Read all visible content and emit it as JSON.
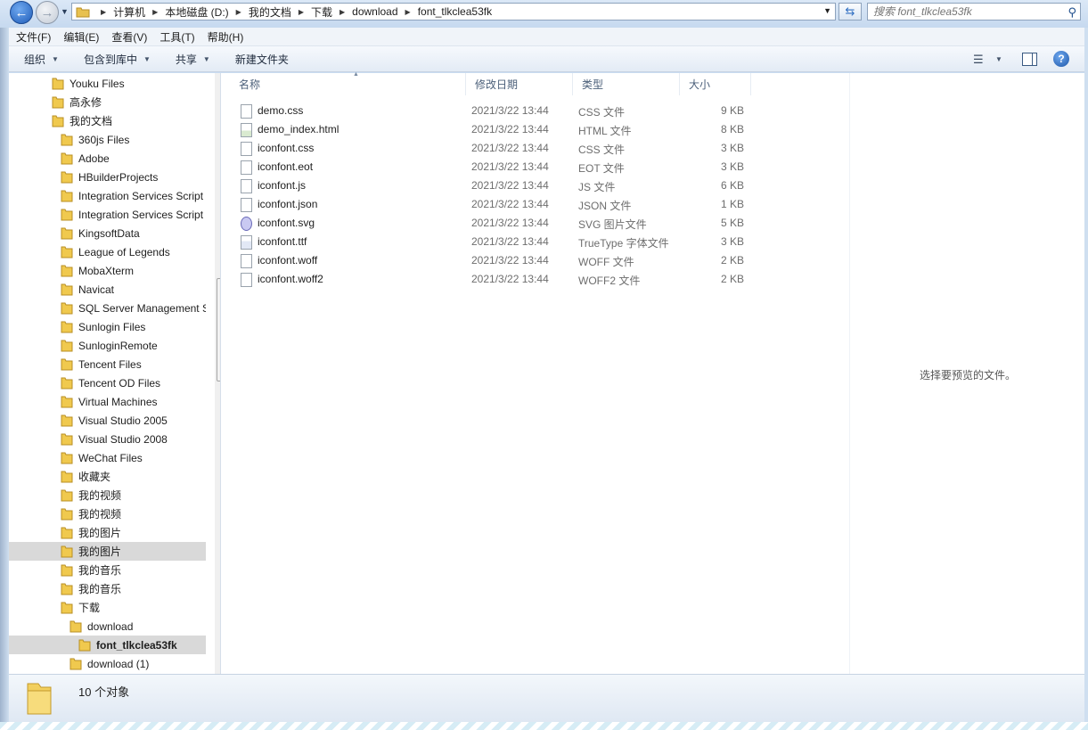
{
  "address_bar": {
    "breadcrumbs": [
      "计算机",
      "本地磁盘 (D:)",
      "我的文档",
      "下载",
      "download",
      "font_tlkclea53fk"
    ]
  },
  "search": {
    "placeholder": "搜索 font_tlkclea53fk"
  },
  "menu": [
    "文件(F)",
    "编辑(E)",
    "查看(V)",
    "工具(T)",
    "帮助(H)"
  ],
  "toolbar": {
    "organize": "组织",
    "include_in_library": "包含到库中",
    "share": "共享",
    "new_folder": "新建文件夹"
  },
  "navigation": {
    "items": [
      {
        "label": "Youku Files",
        "indent": 0
      },
      {
        "label": "高永修",
        "indent": 0
      },
      {
        "label": "我的文档",
        "indent": 0
      },
      {
        "label": "360js Files",
        "indent": 1
      },
      {
        "label": "Adobe",
        "indent": 1
      },
      {
        "label": "HBuilderProjects",
        "indent": 1
      },
      {
        "label": "Integration Services Script C",
        "indent": 1
      },
      {
        "label": "Integration Services Script T",
        "indent": 1
      },
      {
        "label": "KingsoftData",
        "indent": 1
      },
      {
        "label": "League of Legends",
        "indent": 1
      },
      {
        "label": "MobaXterm",
        "indent": 1
      },
      {
        "label": "Navicat",
        "indent": 1
      },
      {
        "label": "SQL Server Management St",
        "indent": 1
      },
      {
        "label": "Sunlogin Files",
        "indent": 1
      },
      {
        "label": "SunloginRemote",
        "indent": 1
      },
      {
        "label": "Tencent Files",
        "indent": 1
      },
      {
        "label": "Tencent OD Files",
        "indent": 1
      },
      {
        "label": "Virtual Machines",
        "indent": 1
      },
      {
        "label": "Visual Studio 2005",
        "indent": 1
      },
      {
        "label": "Visual Studio 2008",
        "indent": 1
      },
      {
        "label": "WeChat Files",
        "indent": 1
      },
      {
        "label": "收藏夹",
        "indent": 1
      },
      {
        "label": "我的视频",
        "indent": 1
      },
      {
        "label": "我的视频",
        "indent": 1
      },
      {
        "label": "我的图片",
        "indent": 1
      },
      {
        "label": "我的图片",
        "indent": 1,
        "highlighted": true
      },
      {
        "label": "我的音乐",
        "indent": 1
      },
      {
        "label": "我的音乐",
        "indent": 1
      },
      {
        "label": "下载",
        "indent": 1
      },
      {
        "label": "download",
        "indent": 2
      },
      {
        "label": "font_tlkclea53fk",
        "indent": 3,
        "selected": true
      },
      {
        "label": "download (1)",
        "indent": 2
      }
    ]
  },
  "file_list": {
    "columns": [
      "名称",
      "修改日期",
      "类型",
      "大小"
    ],
    "files": [
      {
        "name": "demo.css",
        "date": "2021/3/22 13:44",
        "type": "CSS 文件",
        "size": "9 KB",
        "icon": "css-file-icon"
      },
      {
        "name": "demo_index.html",
        "date": "2021/3/22 13:44",
        "type": "HTML 文件",
        "size": "8 KB",
        "icon": "html-file-icon"
      },
      {
        "name": "iconfont.css",
        "date": "2021/3/22 13:44",
        "type": "CSS 文件",
        "size": "3 KB",
        "icon": "css-file-icon"
      },
      {
        "name": "iconfont.eot",
        "date": "2021/3/22 13:44",
        "type": "EOT 文件",
        "size": "3 KB",
        "icon": "blank-file-icon"
      },
      {
        "name": "iconfont.js",
        "date": "2021/3/22 13:44",
        "type": "JS 文件",
        "size": "6 KB",
        "icon": "js-file-icon"
      },
      {
        "name": "iconfont.json",
        "date": "2021/3/22 13:44",
        "type": "JSON 文件",
        "size": "1 KB",
        "icon": "blank-file-icon"
      },
      {
        "name": "iconfont.svg",
        "date": "2021/3/22 13:44",
        "type": "SVG 图片文件",
        "size": "5 KB",
        "icon": "svg-file-icon"
      },
      {
        "name": "iconfont.ttf",
        "date": "2021/3/22 13:44",
        "type": "TrueType 字体文件",
        "size": "3 KB",
        "icon": "font-file-icon"
      },
      {
        "name": "iconfont.woff",
        "date": "2021/3/22 13:44",
        "type": "WOFF 文件",
        "size": "2 KB",
        "icon": "blank-file-icon"
      },
      {
        "name": "iconfont.woff2",
        "date": "2021/3/22 13:44",
        "type": "WOFF2 文件",
        "size": "2 KB",
        "icon": "blank-file-icon"
      }
    ]
  },
  "preview": {
    "message": "选择要预览的文件。"
  },
  "status": {
    "count": "10 个对象"
  }
}
